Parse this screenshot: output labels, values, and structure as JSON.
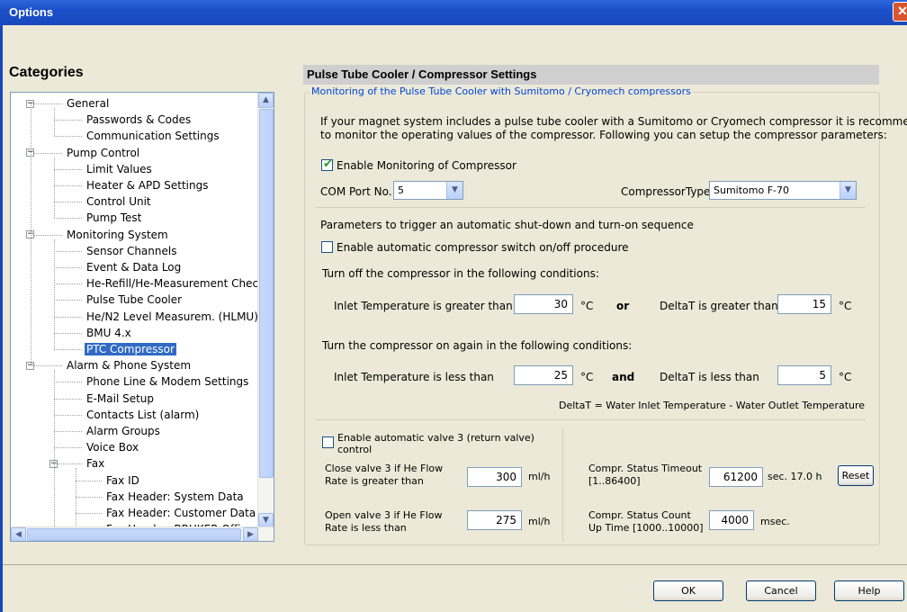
{
  "window": {
    "title": "Options",
    "close": "✕"
  },
  "categories": {
    "title": "Categories",
    "items": [
      {
        "label": "General",
        "level": 0,
        "expander": "−"
      },
      {
        "label": "Passwords & Codes",
        "level": 1
      },
      {
        "label": "Communication Settings",
        "level": 1
      },
      {
        "label": "Pump Control",
        "level": 0,
        "expander": "−"
      },
      {
        "label": "Limit Values",
        "level": 1
      },
      {
        "label": "Heater & APD Settings",
        "level": 1
      },
      {
        "label": "Control Unit",
        "level": 1
      },
      {
        "label": "Pump Test",
        "level": 1
      },
      {
        "label": "Monitoring System",
        "level": 0,
        "expander": "−"
      },
      {
        "label": "Sensor Channels",
        "level": 1
      },
      {
        "label": "Event & Data Log",
        "level": 1
      },
      {
        "label": "He-Refill/He-Measurement Check",
        "level": 1
      },
      {
        "label": "Pulse Tube Cooler",
        "level": 1
      },
      {
        "label": "He/N2 Level Measurem. (HLMU)",
        "level": 1
      },
      {
        "label": "BMU 4.x",
        "level": 1
      },
      {
        "label": "PTC Compressor",
        "level": 1,
        "selected": true
      },
      {
        "label": "Alarm & Phone System",
        "level": 0,
        "expander": "−"
      },
      {
        "label": "Phone Line & Modem Settings",
        "level": 1
      },
      {
        "label": "E-Mail Setup",
        "level": 1
      },
      {
        "label": "Contacts List (alarm)",
        "level": 1
      },
      {
        "label": "Alarm Groups",
        "level": 1
      },
      {
        "label": "Voice Box",
        "level": 1
      },
      {
        "label": "Fax",
        "level": 1,
        "expander": "−"
      },
      {
        "label": "Fax ID",
        "level": 2
      },
      {
        "label": "Fax Header: System Data",
        "level": 2
      },
      {
        "label": "Fax Header: Customer Data",
        "level": 2
      },
      {
        "label": "Fax Header: BRUKER Office",
        "level": 2
      }
    ],
    "scroll_up": "▲",
    "scroll_down": "▼",
    "scroll_left": "◀",
    "scroll_right": "▶"
  },
  "panel": {
    "header": "Pulse Tube Cooler / Compressor Settings",
    "group_legend": "Monitoring of the Pulse Tube Cooler with Sumitomo / Cryomech compressors",
    "intro_line1": "If your magnet system includes a pulse tube cooler with a Sumitomo or Cryomech compressor it is recommended",
    "intro_line2": "to monitor the operating values of the compressor. Following you can setup the compressor parameters:",
    "enable_monitoring": {
      "label": "Enable Monitoring of Compressor",
      "checked": true
    },
    "com_port": {
      "label": "COM Port No.",
      "value": "5"
    },
    "compressor_type": {
      "label": "CompressorType",
      "value": "Sumitomo F-70"
    },
    "params_title": "Parameters to trigger an automatic  shut-down and  turn-on sequence",
    "enable_auto_switch": {
      "label": "Enable automatic compressor switch on/off procedure",
      "checked": false
    },
    "off_title": "Turn off the compressor in the following conditions:",
    "off_inlet": {
      "label": "Inlet Temperature is greater than",
      "value": "30",
      "unit": "°C"
    },
    "off_conj": "or",
    "off_delta": {
      "label": "DeltaT is greater than",
      "value": "15",
      "unit": "°C"
    },
    "on_title": "Turn the compressor on again in the following conditions:",
    "on_inlet": {
      "label": "Inlet Temperature is less than",
      "value": "25",
      "unit": "°C"
    },
    "on_conj": "and",
    "on_delta": {
      "label": "DeltaT is less than",
      "value": "5",
      "unit": "°C"
    },
    "deltat_note": "DeltaT =  Water Inlet Temperature - Water Outlet Temperature",
    "valve": {
      "enable_label_1": "Enable automatic valve 3  (return valve)",
      "enable_label_2": "control",
      "checked": false,
      "close_label_1": "Close valve 3 if He Flow",
      "close_label_2": "Rate is greater than",
      "close_value": "300",
      "close_unit": "ml/h",
      "open_label_1": "Open valve 3 if He Flow",
      "open_label_2": "Rate is less than",
      "open_value": "275",
      "open_unit": "ml/h"
    },
    "status": {
      "timeout_label_1": "Compr. Status Timeout",
      "timeout_label_2": "[1..86400]",
      "timeout_value": "61200",
      "timeout_unit": "sec.  17.0 h",
      "reset_label": "Reset",
      "count_label_1": "Compr. Status Count",
      "count_label_2": "Up Time [1000..10000]",
      "count_value": "4000",
      "count_unit": "msec."
    }
  },
  "footer": {
    "ok": "OK",
    "cancel": "Cancel",
    "help": "Help"
  }
}
